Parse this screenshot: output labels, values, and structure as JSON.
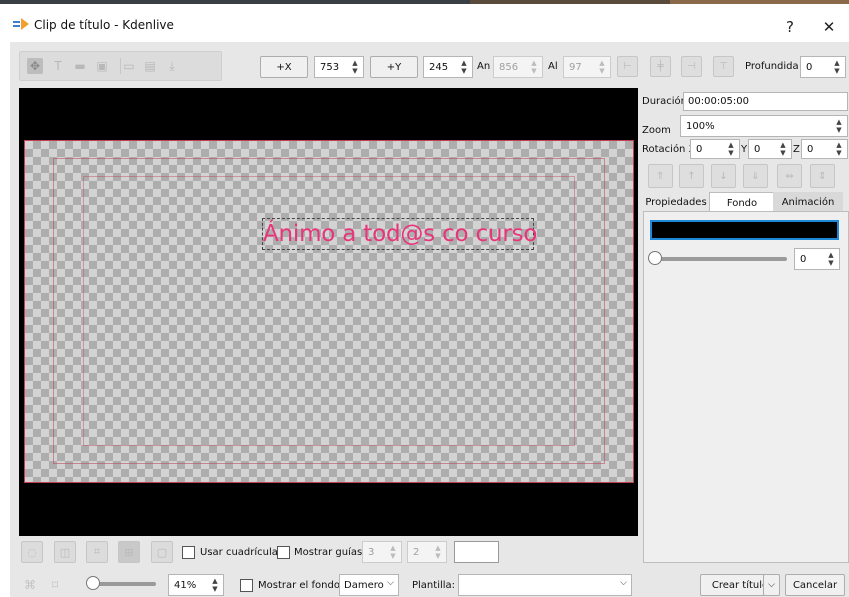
{
  "window": {
    "title": "Clip de título - Kdenlive",
    "help_symbol": "?",
    "close_symbol": "✕"
  },
  "toolbar": {
    "x_button": "+X",
    "x_value": "753",
    "y_button": "+Y",
    "y_value": "245",
    "width_label": "An",
    "width_value": "856",
    "height_label": "Al",
    "height_value": "97",
    "depth_label": "Profundidad",
    "depth_value": "0"
  },
  "canvas": {
    "text_item": "Ánimo a tod@s co curso",
    "text_color": "#e8357a",
    "background": "#000000"
  },
  "properties": {
    "duration_label": "Duración",
    "duration_value": "00:00:05:00",
    "zoom_label": "Zoom",
    "zoom_value": "100%",
    "rotation_label": "Rotación X",
    "rot_x": "0",
    "rot_y_label": "Y",
    "rot_y": "0",
    "rot_z_label": "Z",
    "rot_z": "0",
    "tabs": [
      "Propiedades",
      "Fondo",
      "Animación"
    ],
    "active_tab": "Fondo",
    "background_color": "#000000",
    "opacity_value": "0",
    "accent_color": "#1e88d8"
  },
  "bottom": {
    "show_grid_label": "Usar cuadrícula",
    "show_guides_label": "Mostrar guías",
    "guides_h": "3",
    "guides_v": "2",
    "zoom_value": "41%",
    "show_background_label": "Mostrar el fondo",
    "background_mode": "Damero",
    "template_label": "Plantilla:",
    "template_value": "",
    "create_button": "Crear título",
    "cancel_button": "Cancelar"
  }
}
